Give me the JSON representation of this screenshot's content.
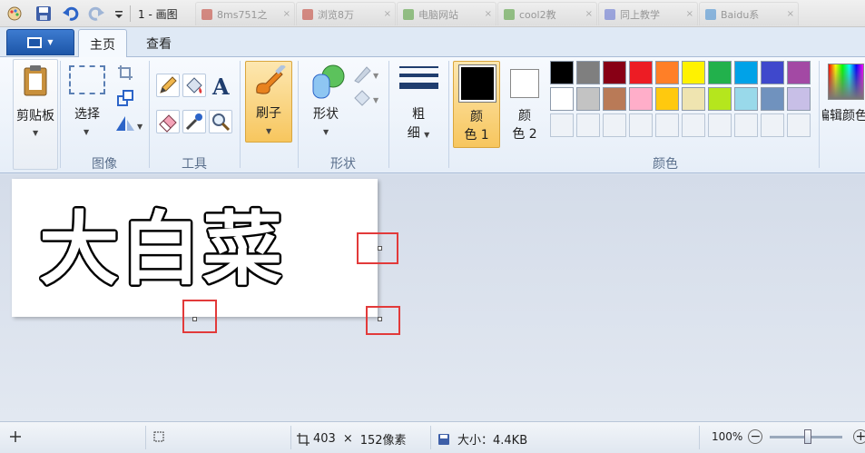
{
  "window": {
    "title": "1 - 画图",
    "qa_icons": [
      "paint-app-icon",
      "save-icon",
      "undo-icon",
      "redo-icon",
      "customize-dropdown-icon"
    ],
    "browser_tabs": [
      {
        "label": "8ms751之",
        "color": "#c0392b"
      },
      {
        "label": "浏览8万",
        "color": "#c0392b"
      },
      {
        "label": "电脑网站",
        "color": "#4a9a30"
      },
      {
        "label": "cool2教",
        "color": "#4a9a30"
      },
      {
        "label": "同上教学",
        "color": "#5a6bd0"
      },
      {
        "label": "Baidu系",
        "color": "#3a88d0"
      }
    ]
  },
  "ribbon_tabs": {
    "app_menu": "app-menu-icon",
    "home": "主页",
    "view": "查看"
  },
  "ribbon": {
    "clipboard": {
      "label": "剪贴板",
      "group": ""
    },
    "image": {
      "select_label": "选择",
      "group": "图像"
    },
    "tools": {
      "group": "工具"
    },
    "brushes": {
      "label": "刷子"
    },
    "shapes": {
      "label": "形状",
      "group": "形状"
    },
    "size": {
      "line1": "粗",
      "line2": "细"
    },
    "color1": {
      "line1": "颜",
      "line2": "色 1"
    },
    "color2": {
      "line1": "颜",
      "line2": "色 2"
    },
    "colors_group": "颜色",
    "edit_colors": "编辑颜色",
    "palette_row1": [
      "#000000",
      "#7f7f7f",
      "#880015",
      "#ed1c24",
      "#ff7f27",
      "#fff200",
      "#22b14c",
      "#00a2e8",
      "#3f48cc",
      "#a349a4"
    ],
    "palette_row2": [
      "#ffffff",
      "#c3c3c3",
      "#b97a57",
      "#ffaec9",
      "#ffc90e",
      "#efe4b0",
      "#b5e61d",
      "#99d9ea",
      "#7092be",
      "#c8bfe7"
    ]
  },
  "canvas": {
    "text": "大白菜"
  },
  "status": {
    "size_w": "403",
    "size_sep": "×",
    "size_h": "152像素",
    "file_size": "大小：4.4KB",
    "zoom": "100%"
  }
}
